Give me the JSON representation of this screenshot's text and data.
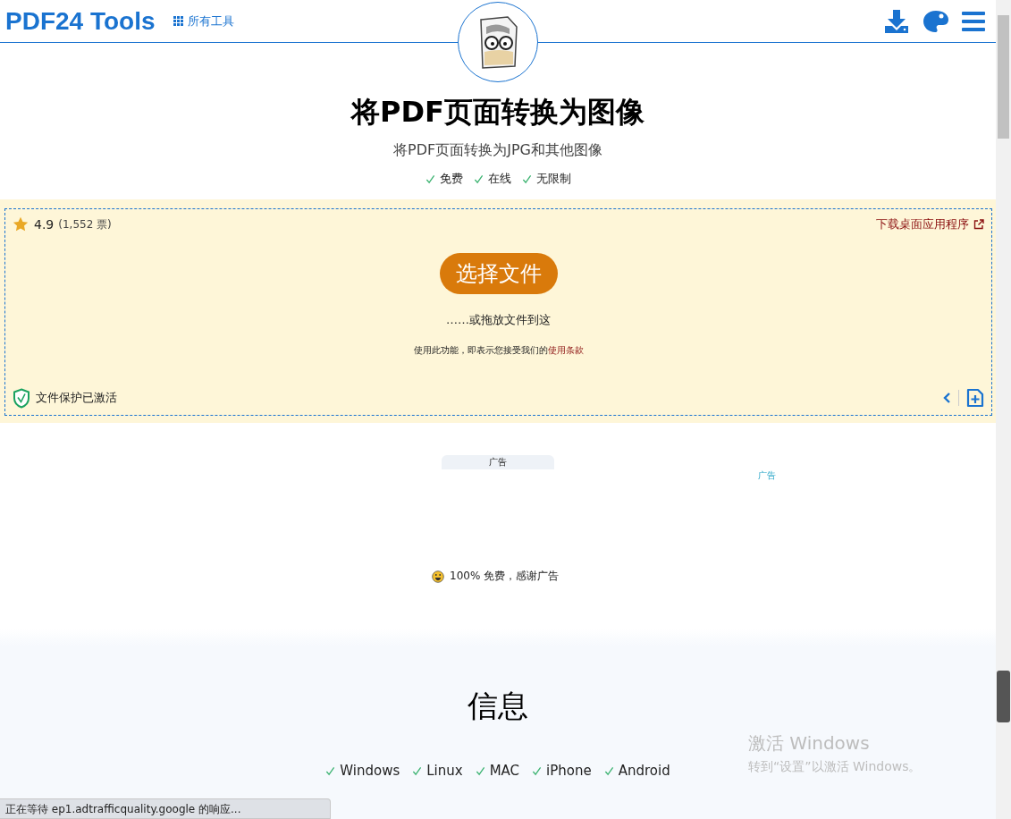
{
  "header": {
    "brand": "PDF24 Tools",
    "all_tools": "所有工具"
  },
  "hero": {
    "title": "将PDF页面转换为图像",
    "subtitle": "将PDF页面转换为JPG和其他图像",
    "features": [
      "免费",
      "在线",
      "无限制"
    ]
  },
  "upload": {
    "rating": "4.9",
    "votes": "(1,552 票)",
    "desktop_link": "下载桌面应用程序",
    "choose_button": "选择文件",
    "drop_hint": "……或拖放文件到这",
    "terms_text": "使用此功能，即表示您接受我们的",
    "terms_link": "使用条款",
    "protection": "文件保护已激活"
  },
  "ads": {
    "tab_label": "广告",
    "side_label": "广告",
    "thanks": "100% 免费，感谢广告"
  },
  "info": {
    "title": "信息",
    "platforms": [
      "Windows",
      "Linux",
      "MAC",
      "iPhone",
      "Android"
    ]
  },
  "os_overlay": {
    "title": "激活 Windows",
    "hint": "转到“设置”以激活 Windows。"
  },
  "status_bar": {
    "text": "正在等待 ep1.adtrafficquality.google 的响应..."
  }
}
